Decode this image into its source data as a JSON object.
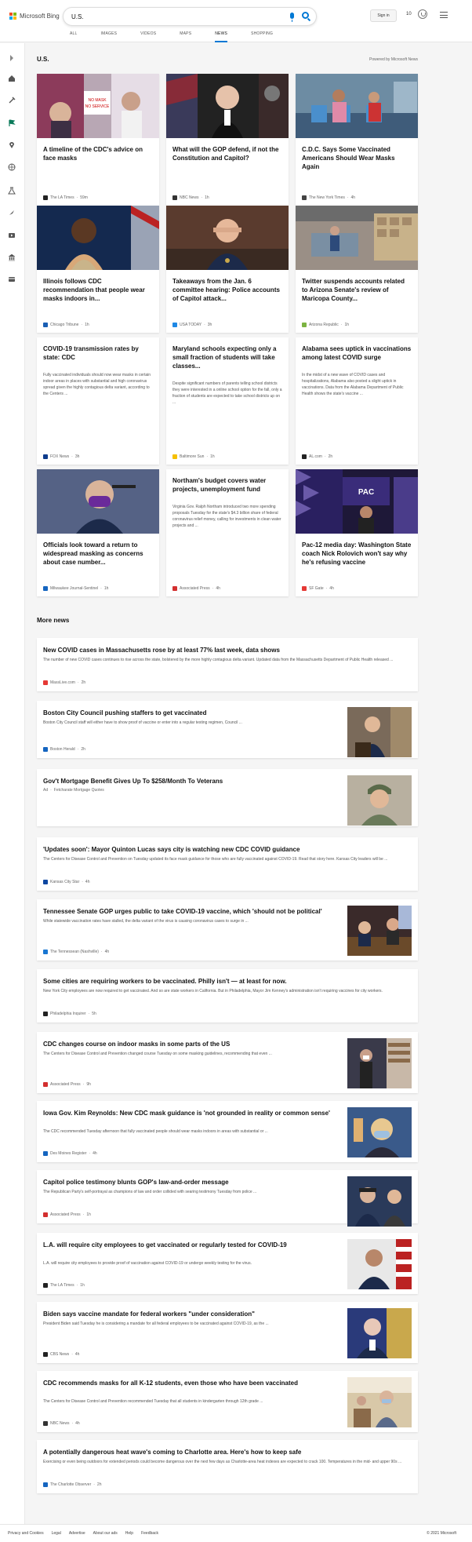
{
  "header": {
    "logo_text": "Microsoft Bing",
    "search_value": "U.S.",
    "sign_in": "Sign in",
    "points": "10"
  },
  "tabs": [
    {
      "label": "ALL"
    },
    {
      "label": "IMAGES"
    },
    {
      "label": "VIDEOS"
    },
    {
      "label": "MAPS"
    },
    {
      "label": "NEWS",
      "active": true
    },
    {
      "label": "SHOPPING"
    }
  ],
  "section": {
    "title": "U.S.",
    "powered": "Powered by Microsoft News"
  },
  "cards": [
    {
      "title": "A timeline of the CDC's advice on face masks",
      "source": "The LA Times",
      "time": "59m",
      "icon_color": "#222222",
      "image": "img-mask-sign"
    },
    {
      "title": "What will the GOP defend, if not the Constitution and Capitol?",
      "source": "NBC News",
      "time": "1h",
      "icon_color": "#333333",
      "image": "img-speaker-podium"
    },
    {
      "title": "C.D.C. Says Some Vaccinated Americans Should Wear Masks Again",
      "source": "The New York Times",
      "time": "4h",
      "icon_color": "#444444",
      "image": "img-waiting-room"
    },
    {
      "title": "Illinois follows CDC recommendation that people wear masks indoors in...",
      "source": "Chicago Tribune",
      "time": "1h",
      "icon_color": "#1a5fb4",
      "image": "img-woman-speaker"
    },
    {
      "title": "Takeaways from the Jan. 6 committee hearing: Police accounts of Capitol attack...",
      "source": "USA TODAY",
      "time": "3h",
      "icon_color": "#1e88e5",
      "image": "img-officer-hearing"
    },
    {
      "title": "Twitter suspends accounts related to Arizona Senate's review of Maricopa County...",
      "source": "Arizona Republic",
      "time": "1h",
      "icon_color": "#7cb342",
      "image": "img-warehouse"
    },
    {
      "title": "COVID-19 transmission rates by state: CDC",
      "desc": "Fully vaccinated individuals should now wear masks in certain indoor areas in places with substantial and high coronavirus spread given the highly contagious delta variant, according to the Centers ...",
      "source": "FOX News",
      "time": "3h",
      "icon_color": "#0d3b8c"
    },
    {
      "title": "Maryland schools expecting only a small fraction of students will take classes...",
      "desc": "Despite significant numbers of parents telling school districts they were interested in a online school option for the fall, only a fraction of students are expected to take school districts up on ...",
      "source": "Baltimore Sun",
      "time": "1h",
      "icon_color": "#f6c000"
    },
    {
      "title": "Alabama sees uptick in vaccinations among latest COVID surge",
      "desc": "In the midst of a new wave of COVID cases and hospitalizations, Alabama also posted a slight uptick in vaccinations. Data from the Alabama Department of Public Health shows the state's vaccine ...",
      "source": "AL.com",
      "time": "2h",
      "icon_color": "#222222"
    },
    {
      "title": "Officials look toward a return to widespread masking as concerns about case number...",
      "source": "Milwaukee Journal-Sentinel",
      "time": "1h",
      "icon_color": "#1565c0",
      "image": "img-purple-mask"
    },
    {
      "title": "Northam's budget covers water projects, unemployment fund",
      "desc": "Virginia Gov. Ralph Northam introduced two more spending proposals Tuesday for the state's $4.3 billion share of federal coronavirus relief money, calling for investments in clean water projects and ...",
      "source": "Associated Press",
      "time": "4h",
      "icon_color": "#d32f2f"
    },
    {
      "title": "Pac-12 media day: Washington State coach Nick Rolovich won't say why he's refusing vaccine",
      "source": "SF Gate",
      "time": "4h",
      "icon_color": "#e53935",
      "image": "img-pac12-stage"
    }
  ],
  "more": {
    "title": "More news",
    "items": [
      {
        "title": "New COVID cases in Massachusetts rose by at least 77% last week, data shows",
        "desc": "The number of new COVID cases continues to rise across the state, bolstered by the more highly contagious delta variant. Updated data from the Massachusetts Department of Public Health released ...",
        "source": "MassLive.com",
        "time": "2h",
        "icon_color": "#e53935"
      },
      {
        "title": "Boston City Council pushing staffers to get vaccinated",
        "desc": "Boston City Council staff will either have to show proof of vaccine or enter into a regular testing regimen, Council ...",
        "source": "Boston Herald",
        "time": "2h",
        "icon_color": "#1565c0",
        "image": "img-council-man"
      },
      {
        "title": "Gov't Mortgage Benefit Gives Up To $258/Month To Veterans",
        "ad": "Ad",
        "source": "Fetcharate Mortgage Quotes",
        "image": "img-soldier"
      },
      {
        "title": "'Updates soon': Mayor Quinton Lucas says city is watching new CDC COVID guidance",
        "desc": "The Centers for Disease Control and Prevention on Tuesday updated its face mask guidance for those who are fully vaccinated against COVID-19. Read that story here. Kansas City leaders will be ...",
        "source": "Kansas City Star",
        "time": "4h",
        "icon_color": "#0d47a1"
      },
      {
        "title": "Tennessee Senate GOP urges public to take COVID-19 vaccine, which 'should not be political'",
        "desc": "While statewide vaccination rates have stalled, the delta variant of the virus is causing coronavirus cases to surge in ...",
        "source": "The Tennessean (Nashville)",
        "time": "4h",
        "icon_color": "#1976d2",
        "image": "img-senate-meeting"
      },
      {
        "title": "Some cities are requiring workers to be vaccinated. Philly isn't — at least for now.",
        "desc": "New York City employees are now required to get vaccinated. And so are state workers in California. But in Philadelphia, Mayor Jim Kenney's administration isn't requiring vaccines for city workers.",
        "source": "Philadelphia Inquirer",
        "time": "5h",
        "icon_color": "#222222"
      },
      {
        "title": "CDC changes course on indoor masks in some parts of the US",
        "desc": "The Centers for Disease Control and Prevention changed course Tuesday on some masking guidelines, recommending that even ...",
        "source": "Associated Press",
        "time": "9h",
        "icon_color": "#d32f2f",
        "image": "img-store-shoppers"
      },
      {
        "title": "Iowa Gov. Kim Reynolds: New CDC mask guidance is 'not grounded in reality or common sense'",
        "desc": "The CDC recommended Tuesday afternoon that fully vaccinated people should wear masks indoors in areas with substantial or ...",
        "source": "Des Moines Register",
        "time": "4h",
        "icon_color": "#1565c0",
        "image": "img-blonde-mask"
      },
      {
        "title": "Capitol police testimony blunts GOP's law-and-order message",
        "desc": "The Republican Party's self-portrayal as champions of law and order collided with searing testimony Tuesday from police ...",
        "source": "Associated Press",
        "time": "1h",
        "icon_color": "#d32f2f",
        "image": "img-police-hearing"
      },
      {
        "title": "L.A. will require city employees to get vaccinated or regularly tested for COVID-19",
        "desc": "L.A. will require city employees to provide proof of vaccination against COVID-19 or undergo weekly testing for the virus.",
        "source": "The LA Times",
        "time": "1h",
        "icon_color": "#222222",
        "image": "img-mayor-flag"
      },
      {
        "title": "Biden says vaccine mandate for federal workers \"under consideration\"",
        "desc": "President Biden said Tuesday he is considering a mandate for all federal employees to be vaccinated against COVID-19, as the ...",
        "source": "CBS News",
        "time": "4h",
        "icon_color": "#222222",
        "image": "img-biden"
      },
      {
        "title": "CDC recommends masks for all K-12 students, even those who have been vaccinated",
        "desc": "The Centers for Disease Control and Prevention recommended Tuesday that all students in kindergarten through 12th grade ...",
        "source": "NBC News",
        "time": "4h",
        "icon_color": "#333333",
        "image": "img-classroom"
      },
      {
        "title": "A potentially dangerous heat wave's coming to Charlotte area. Here's how to keep safe",
        "desc": "Exercising or even being outdoors for extended periods could become dangerous over the next few days as Charlotte-area heat indexes are expected to crack 100. Temperatures in the mid- and upper 90s ...",
        "source": "The Charlotte Observer",
        "time": "2h",
        "icon_color": "#1565c0"
      }
    ]
  },
  "footer": {
    "links": [
      "Privacy and Cookies",
      "Legal",
      "Advertise",
      "About our ads",
      "Help",
      "Feedback"
    ],
    "copyright": "© 2021 Microsoft"
  },
  "sidebar_icons": [
    "expand-icon",
    "home-icon",
    "tools-icon",
    "flag-icon",
    "location-icon",
    "globe-icon",
    "science-icon",
    "rocket-icon",
    "video-icon",
    "bank-icon",
    "card-icon"
  ]
}
